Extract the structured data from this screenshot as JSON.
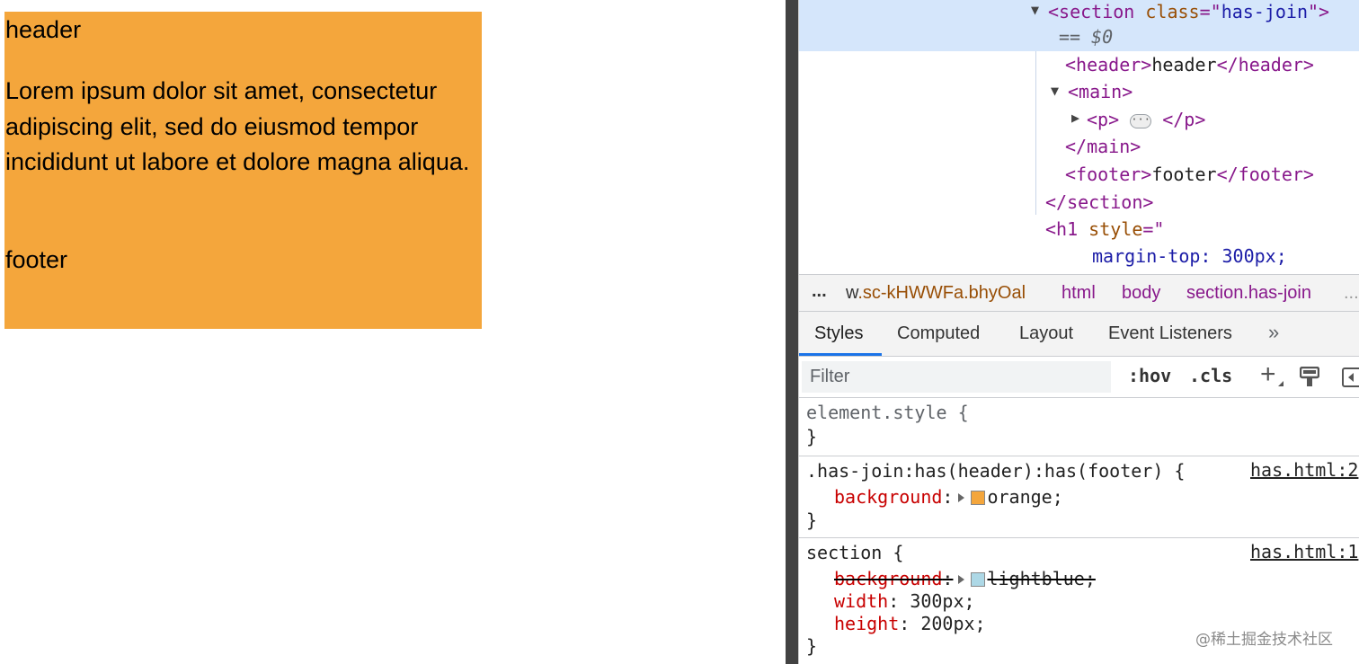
{
  "preview": {
    "header": "header",
    "paragraph": "Lorem ipsum dolor sit amet, consectetur adipiscing elit, sed do eiusmod tempor incididunt ut labore et dolore magna aliqua.",
    "footer": "footer",
    "section_color": "#f4a63c"
  },
  "elements_tree": {
    "section_open": "<section",
    "section_attr_name": "class",
    "section_attr_eq": "=\"",
    "section_attr_value": "has-join",
    "section_attr_close": "\">",
    "selected_marker": "== $0",
    "header_open": "<header>",
    "header_text": "header",
    "header_close": "</header>",
    "main_open": "<main>",
    "p_open": "<p>",
    "p_close": "</p>",
    "main_close": "</main>",
    "footer_open": "<footer>",
    "footer_text": "footer",
    "footer_close": "</footer>",
    "section_close": "</section>",
    "h1_open": "<h1",
    "h1_attr_name": "style",
    "h1_attr_eq": "=\"",
    "h1_style_value": "margin-top: 300px;"
  },
  "breadcrumb": {
    "more": "...",
    "first_prefix": "w",
    "first": ".sc-kHWWFa.bhyOal",
    "items": [
      "html",
      "body",
      "section.has-join"
    ],
    "overflow": "..."
  },
  "tabs": [
    "Styles",
    "Computed",
    "Layout",
    "Event Listeners"
  ],
  "tabs_more": "»",
  "filter": {
    "placeholder": "Filter",
    "hov": ":hov",
    "cls": ".cls",
    "plus": "+"
  },
  "rules": {
    "element_style": {
      "selector": "element.style {",
      "close": "}"
    },
    "has_join": {
      "selector": ".has-join:has(header):has(footer) {",
      "source": "has.html:2",
      "property": "background",
      "value": "orange;",
      "swatch": "#f4a63c",
      "close": "}"
    },
    "section": {
      "selector": "section {",
      "source": "has.html:1",
      "props": [
        {
          "name": "background",
          "value": "lightblue;",
          "swatch": "#add8e6",
          "struck": true
        },
        {
          "name": "width",
          "value": "300px;"
        },
        {
          "name": "height",
          "value": "200px;"
        }
      ],
      "close": "}"
    }
  },
  "watermark": "@稀土掘金技术社区"
}
